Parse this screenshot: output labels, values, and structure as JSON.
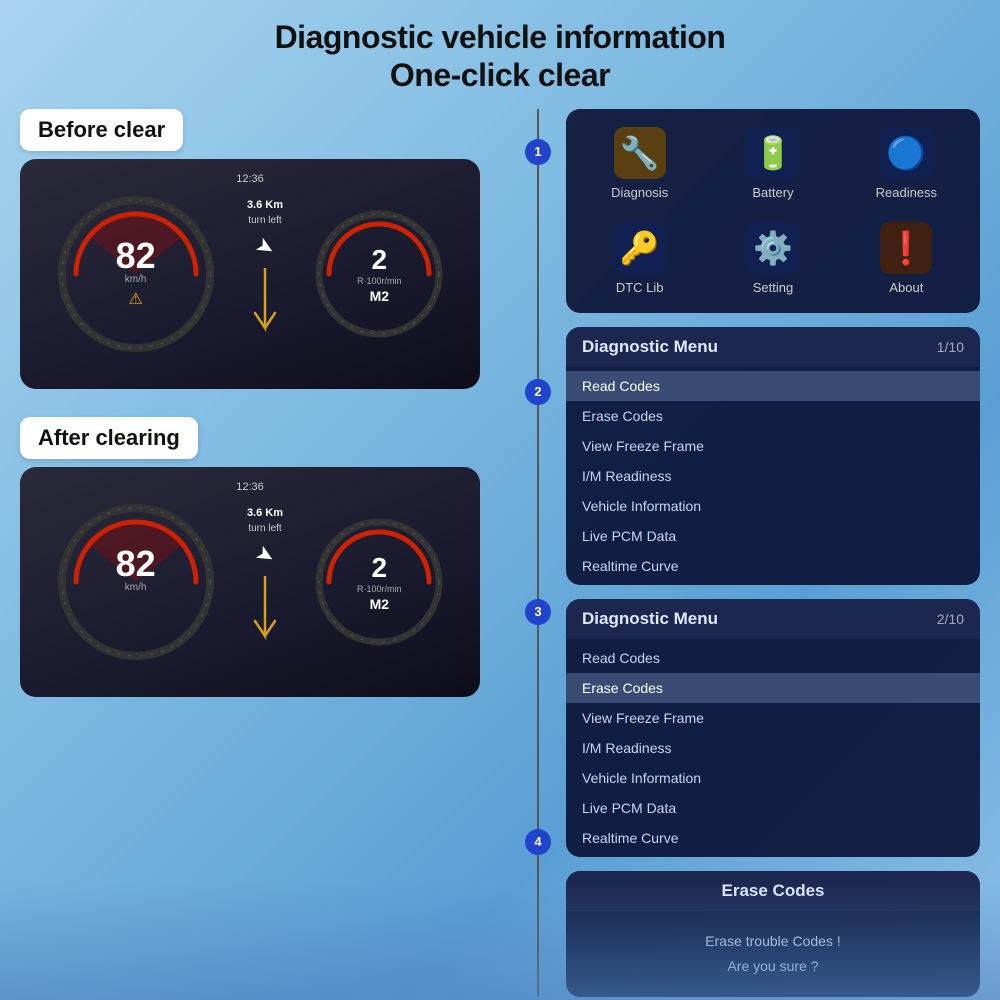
{
  "page": {
    "title_line1": "Diagnostic vehicle information",
    "title_line2": "One-click clear"
  },
  "labels": {
    "before_clear": "Before clear",
    "after_clearing": "After clearing"
  },
  "dashboard": {
    "time": "12:36",
    "speed": "82",
    "speed_unit": "km/h",
    "rpm_value": "2",
    "rpm_unit": "R·100r/min",
    "gear": "M2",
    "nav_distance": "3.6 Km",
    "nav_direction": "turn left"
  },
  "feature_grid": {
    "items": [
      {
        "id": "diagnosis",
        "icon": "🔧",
        "label": "Diagnosis",
        "bg": "#3a3020"
      },
      {
        "id": "battery",
        "icon": "🔋",
        "label": "Battery",
        "bg": "#202840"
      },
      {
        "id": "readiness",
        "icon": "🔵",
        "label": "Readiness",
        "bg": "#202840"
      },
      {
        "id": "dtc_lib",
        "icon": "🔑",
        "label": "DTC Lib",
        "bg": "#202840"
      },
      {
        "id": "setting",
        "icon": "⚙️",
        "label": "Setting",
        "bg": "#202840"
      },
      {
        "id": "about",
        "icon": "❗",
        "label": "About",
        "bg": "#302820"
      }
    ]
  },
  "diag_menu_1": {
    "title": "Diagnostic Menu",
    "page": "1/10",
    "items": [
      {
        "label": "Read Codes",
        "active": true
      },
      {
        "label": "Erase Codes",
        "active": false
      },
      {
        "label": "View Freeze Frame",
        "active": false
      },
      {
        "label": "I/M Readiness",
        "active": false
      },
      {
        "label": "Vehicle Information",
        "active": false
      },
      {
        "label": "Live PCM Data",
        "active": false
      },
      {
        "label": "Realtime Curve",
        "active": false
      }
    ]
  },
  "diag_menu_2": {
    "title": "Diagnostic Menu",
    "page": "2/10",
    "items": [
      {
        "label": "Read Codes",
        "active": false
      },
      {
        "label": "Erase Codes",
        "active": true
      },
      {
        "label": "View Freeze Frame",
        "active": false
      },
      {
        "label": "I/M Readiness",
        "active": false
      },
      {
        "label": "Vehicle Information",
        "active": false
      },
      {
        "label": "Live PCM Data",
        "active": false
      },
      {
        "label": "Realtime Curve",
        "active": false
      }
    ]
  },
  "erase_card": {
    "title": "Erase Codes",
    "line1": "Erase trouble Codes !",
    "line2": "Are you sure ?"
  },
  "steps": [
    "1",
    "2",
    "3",
    "4"
  ]
}
